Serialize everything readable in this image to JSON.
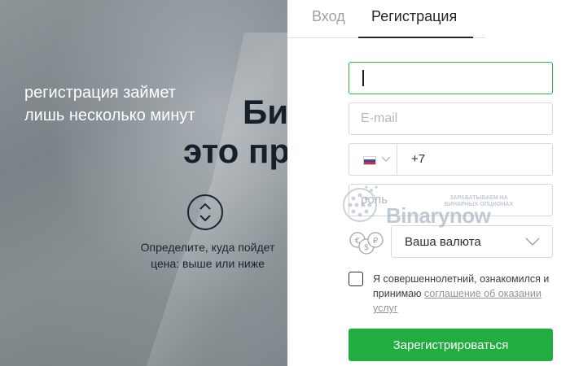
{
  "left": {
    "tagline_line1": "регистрация займет",
    "tagline_line2": "лишь несколько минут",
    "hero_line1": "Би",
    "hero_line2": "это пр",
    "hint_line1": "Определите, куда пойдет",
    "hint_line2": "цена: выше или ниже"
  },
  "tabs": [
    {
      "label": "Вход",
      "active": false
    },
    {
      "label": "Регистрация",
      "active": true
    }
  ],
  "form": {
    "name_value": "",
    "email_placeholder": "E-mail",
    "phone_country_flag": "russia-flag",
    "phone_value": "+7",
    "password_placeholder": "роль",
    "currency_label": "Ваша валюта",
    "consent_text": "Я совершеннолетний, ознакомился и принимаю",
    "consent_link": "соглашение об оказании услуг",
    "submit_label": "Зарегистрироваться"
  },
  "watermark": {
    "brand": "Binarynow",
    "line1": "ЗАРАБАТЫВАЕМ НА",
    "line2": "БИНАРНЫХ ОПЦИОНАХ"
  },
  "colors": {
    "accent": "#21ad3f",
    "active_border": "#2fb54a",
    "text_dark": "#23272b"
  }
}
